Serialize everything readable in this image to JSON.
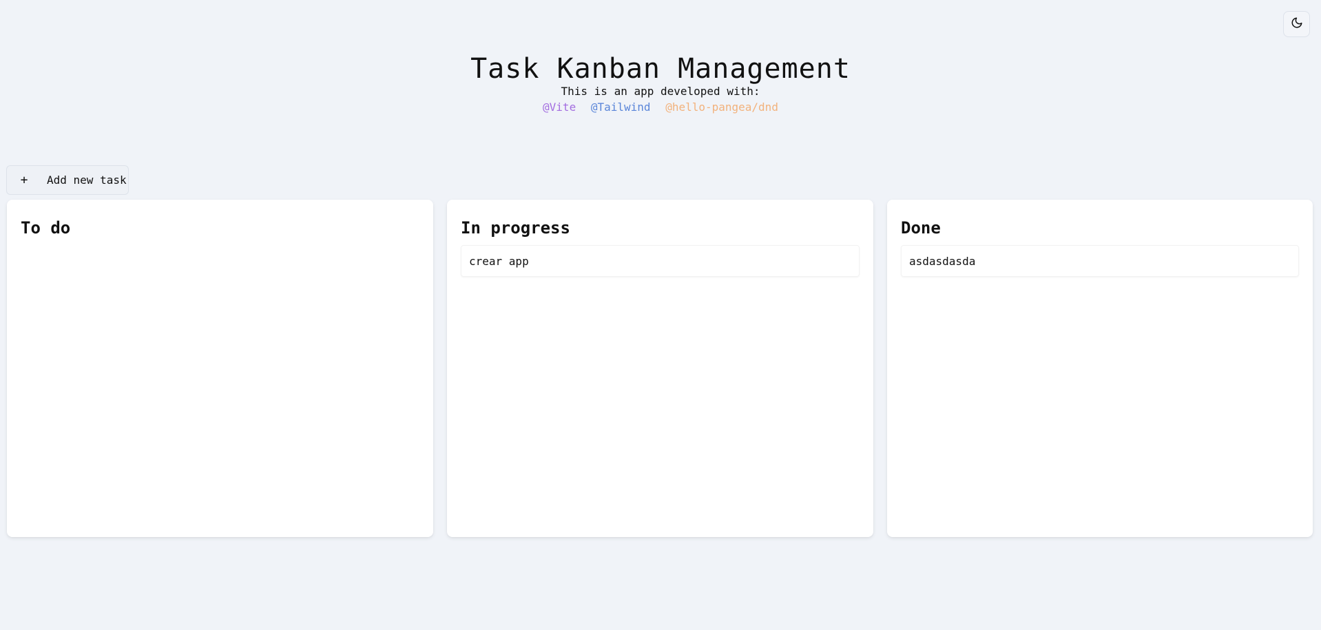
{
  "theme_toggle": {
    "icon": "moon-icon"
  },
  "header": {
    "title": "Task Kanban Management",
    "subtitle": "This is an app developed with:",
    "tech_links": [
      {
        "label": "@Vite",
        "color": "#a36de0"
      },
      {
        "label": "@Tailwind",
        "color": "#5b86d9"
      },
      {
        "label": "@hello-pangea/dnd",
        "color": "#f2b27c"
      }
    ]
  },
  "toolbar": {
    "add_label": "Add new task",
    "add_icon": "plus-icon"
  },
  "columns": [
    {
      "title": "To do",
      "tasks": []
    },
    {
      "title": "In progress",
      "tasks": [
        {
          "text": "crear app"
        }
      ]
    },
    {
      "title": "Done",
      "tasks": [
        {
          "text": "asdasdasda"
        }
      ]
    }
  ]
}
